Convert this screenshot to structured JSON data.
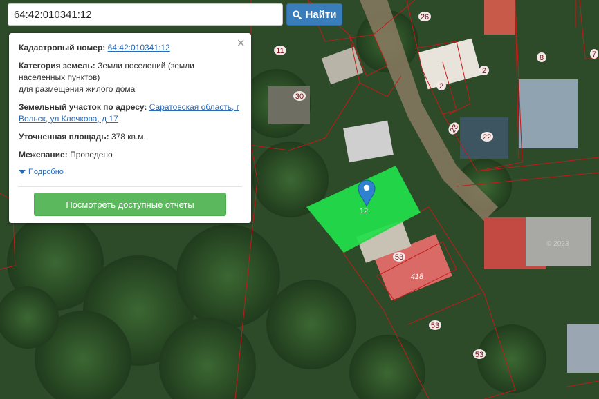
{
  "search": {
    "value": "64:42:010341:12",
    "button_label": "Найти"
  },
  "info_panel": {
    "cadastral_label": "Кадастровый номер:",
    "cadastral_value": "64:42:010341:12",
    "category_label": "Категория земель:",
    "category_value_line1": "Земли поселений (земли",
    "category_value_line2": "населенных пунктов)",
    "category_value_line3": "для размещения жилого дома",
    "address_label": "Земельный участок по адресу:",
    "address_value_line1": "Саратовская область, г",
    "address_value_line2": "Вольск, ул Клочкова, д 17",
    "area_label": "Уточненная площадь:",
    "area_value": "378 кв.м.",
    "survey_label": "Межевание:",
    "survey_value": "Проведено",
    "details_link": "Подробно",
    "reports_button": "Посмотреть доступные отчеты",
    "close_symbol": "×"
  },
  "map": {
    "selected_parcel_label": "12",
    "parcel_numbers": [
      "26",
      "8",
      "11",
      "30",
      "2",
      "2",
      "23",
      "22",
      "53",
      "418",
      "53",
      "53",
      "7"
    ],
    "watermark": "© 2023",
    "selected_color": "#22e04a",
    "boundary_color": "#c21b1b"
  }
}
